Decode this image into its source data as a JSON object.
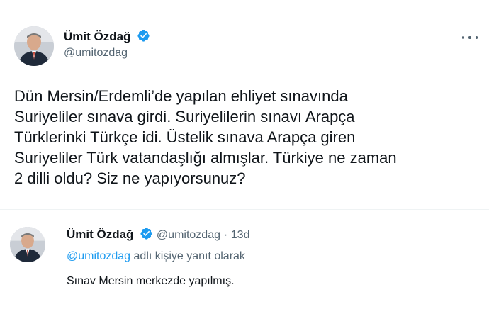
{
  "main_tweet": {
    "display_name": "Ümit Özdağ",
    "handle": "@umitozdag",
    "text": "Dün Mersin/Erdemli’de yapılan ehliyet sınavında\nSuriyeliler sınava girdi. Suriyelilerin sınavı Arapça\nTürklerinki Türkçe idi. Üstelik sınava Arapça giren\nSuriyeliler Türk vatandaşlığı almışlar. Türkiye ne zaman\n2 dilli oldu? Siz ne yapıyorsunuz?",
    "menu_icon": "more-horizontal-icon"
  },
  "reply_tweet": {
    "display_name": "Ümit Özdağ",
    "handle": "@umitozdag",
    "separator": "·",
    "time": "13d",
    "reply_to_handle": "@umitozdag",
    "reply_to_suffix": "adlı kişiye yanıt olarak",
    "text": "Sınav Mersin merkezde yapılmış."
  },
  "colors": {
    "text": "#0f1419",
    "secondary": "#536471",
    "accent": "#1d9bf0",
    "divider": "#eff3f4"
  },
  "icons": {
    "verified": "verified-badge-icon",
    "more": "more-horizontal-icon"
  }
}
